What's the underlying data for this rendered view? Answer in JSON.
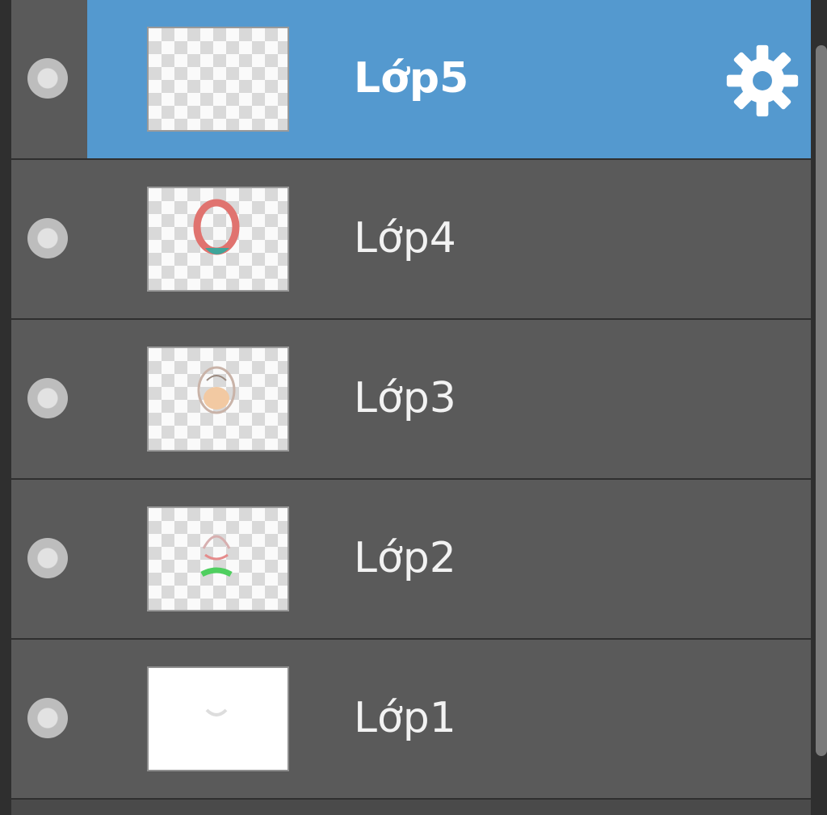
{
  "layers": [
    {
      "name": "Lớp5",
      "selected": true
    },
    {
      "name": "Lớp4",
      "selected": false
    },
    {
      "name": "Lớp3",
      "selected": false
    },
    {
      "name": "Lớp2",
      "selected": false
    },
    {
      "name": "Lớp1",
      "selected": false
    }
  ],
  "colors": {
    "selected_row": "#5499cf",
    "row_background": "#5a5a5a",
    "panel_background": "#2f2f2f"
  },
  "icons": {
    "settings": "gear-icon",
    "visibility": "visibility-dot-icon"
  }
}
